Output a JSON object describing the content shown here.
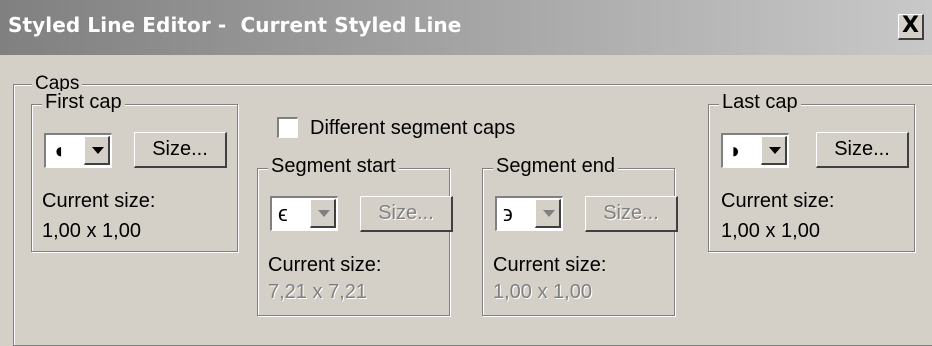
{
  "window": {
    "title": "Styled Line Editor -  Current Styled Line",
    "close_label": "X"
  },
  "caps_group": {
    "label": "Caps"
  },
  "different_segment_caps": {
    "label": "Different segment caps",
    "checked": false
  },
  "first_cap": {
    "label": "First cap",
    "glyph": "◖",
    "size_button": "Size...",
    "size_caption": "Current size:",
    "size_value": "1,00 x 1,00"
  },
  "segment_start": {
    "label": "Segment start",
    "glyph": "ϵ",
    "size_button": "Size...",
    "size_caption": "Current size:",
    "size_value": "7,21 x 7,21"
  },
  "segment_end": {
    "label": "Segment end",
    "glyph": "϶",
    "size_button": "Size...",
    "size_caption": "Current size:",
    "size_value": "1,00 x 1,00"
  },
  "last_cap": {
    "label": "Last cap",
    "glyph": "◗",
    "size_button": "Size...",
    "size_caption": "Current size:",
    "size_value": "1,00 x 1,00"
  }
}
